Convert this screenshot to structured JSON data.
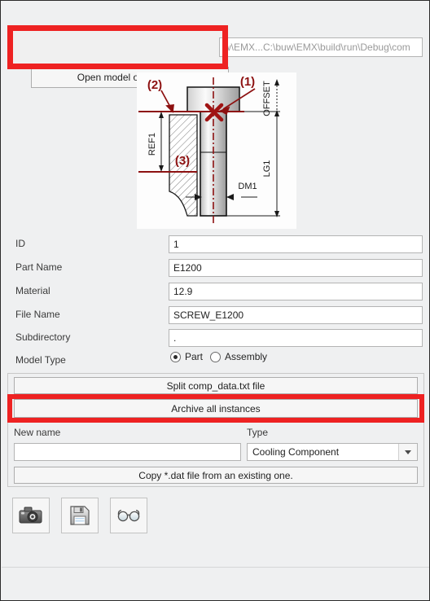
{
  "toolbar": {
    "open_button_label": "Open model or *.dat file.",
    "path_value": "w\\EMX...C:\\buw\\EMX\\build\\run\\Debug\\com"
  },
  "drawing": {
    "callout_1": "(1)",
    "callout_2": "(2)",
    "callout_3": "(3)",
    "dim_offset": "OFFSET",
    "dim_ref1": "REF1",
    "dim_lg1": "LG1",
    "dim_dm1": "DM1"
  },
  "form": {
    "rows": [
      {
        "label": "ID",
        "value": "1"
      },
      {
        "label": "Part Name",
        "value": "E1200"
      },
      {
        "label": "Material",
        "value": "12.9"
      },
      {
        "label": "File Name",
        "value": "SCREW_E1200"
      },
      {
        "label": "Subdirectory",
        "value": "."
      }
    ],
    "model_type": {
      "label": "Model Type",
      "options": [
        "Part",
        "Assembly"
      ],
      "selected": "Part"
    }
  },
  "actions": {
    "split_label": "Split comp_data.txt file",
    "archive_label": "Archive all instances",
    "new_name_label": "New name",
    "new_name_value": "",
    "type_label": "Type",
    "type_selected": "Cooling Component",
    "copy_label": "Copy *.dat file from an existing one."
  },
  "icons": {
    "camera": "camera-icon",
    "save": "floppy-disk-icon",
    "view": "glasses-icon"
  },
  "highlights": {
    "color": "#ee2222",
    "targets": [
      "Open model or *.dat file.",
      "Archive all instances"
    ]
  }
}
